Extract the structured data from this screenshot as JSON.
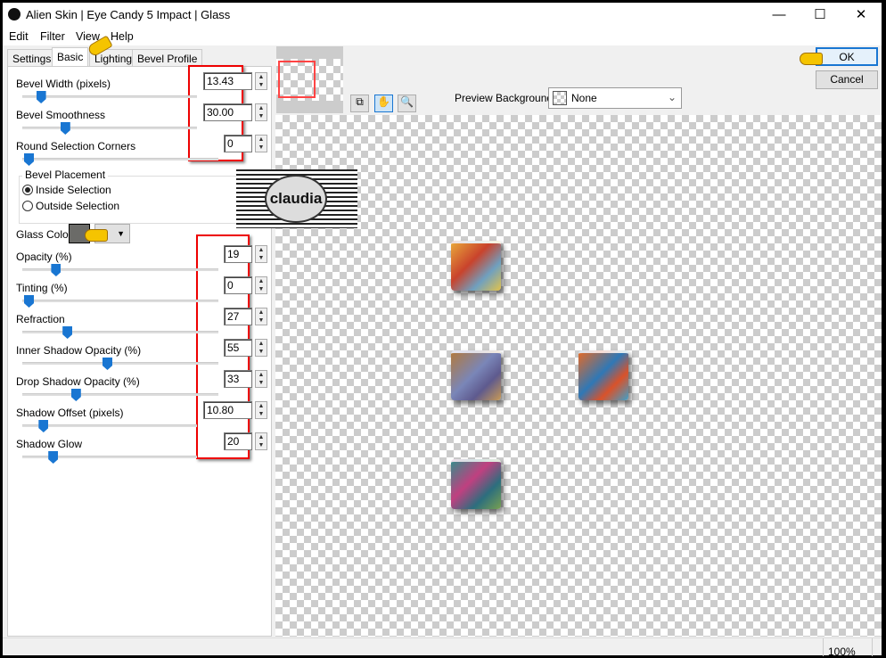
{
  "window": {
    "title": "Alien Skin | Eye Candy 5 Impact | Glass",
    "minimize": "—",
    "maximize": "☐",
    "close": "✕"
  },
  "menu": [
    "Edit",
    "Filter",
    "View",
    "Help"
  ],
  "tabs": [
    "Settings",
    "Basic",
    "Lighting",
    "Bevel Profile"
  ],
  "active_tab": "Basic",
  "bevel_controls": [
    {
      "label": "Bevel Width (pixels)",
      "value": "13.43",
      "level": 0.1
    },
    {
      "label": "Bevel Smoothness",
      "value": "30.00",
      "level": 0.3
    },
    {
      "label": "Round Selection Corners",
      "value": "0",
      "level": 0
    }
  ],
  "bevel_placement": {
    "title": "Bevel Placement",
    "options": [
      "Inside Selection",
      "Outside Selection"
    ],
    "selected": "Inside Selection"
  },
  "watermark": "claudia",
  "glass_color": {
    "label": "Glass Color",
    "color": "#6b6b68"
  },
  "glass_controls": [
    {
      "label": "Opacity (%)",
      "value": "19",
      "level": 0.19
    },
    {
      "label": "Tinting (%)",
      "value": "0",
      "level": 0
    },
    {
      "label": "Refraction",
      "value": "27",
      "level": 0.27
    },
    {
      "label": "Inner Shadow Opacity (%)",
      "value": "55",
      "level": 0.55
    },
    {
      "label": "Drop Shadow Opacity (%)",
      "value": "33",
      "level": 0.33
    },
    {
      "label": "Shadow Offset (pixels)",
      "value": "10.80",
      "level": 0.12
    },
    {
      "label": "Shadow Glow",
      "value": "20",
      "level": 0.2
    }
  ],
  "preview": {
    "background_label": "Preview Background:",
    "background_value": "None",
    "zoom": "100%"
  },
  "buttons": {
    "ok": "OK",
    "cancel": "Cancel"
  },
  "colors": {
    "accent": "#1976d2",
    "highlight": "#e00000"
  }
}
